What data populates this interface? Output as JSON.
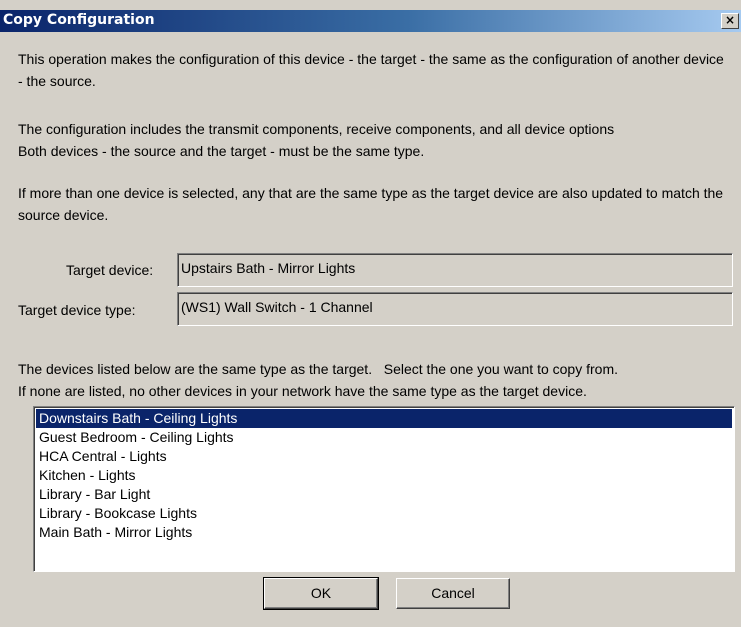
{
  "window": {
    "title": "Copy Configuration",
    "close_glyph": "×"
  },
  "description": {
    "p1": "This operation makes the configuration of this device - the target - the same as the configuration of another device - the source.",
    "p2_line1": "The configuration includes the transmit components, receive components, and all device options",
    "p2_line2": "Both devices - the source and the target - must be the same type.",
    "p3": "If more than one device is selected, any that are the same type as the target device are also updated to match the source device."
  },
  "target": {
    "device_label": "Target device:",
    "device_value": "Upstairs Bath - Mirror Lights",
    "type_label": "Target device type:",
    "type_value": "(WS1) Wall Switch - 1 Channel"
  },
  "list": {
    "instructions_line1": "The devices listed below are the same type as the target.   Select the one you want to copy from.",
    "instructions_line2": "If none are listed, no other devices in your network have the same type as the target device.",
    "selected_index": 0,
    "items": [
      "Downstairs Bath - Ceiling Lights",
      "Guest Bedroom - Ceiling Lights",
      "HCA Central - Lights",
      "Kitchen - Lights",
      "Library - Bar Light",
      "Library - Bookcase Lights",
      "Main Bath - Mirror Lights"
    ]
  },
  "buttons": {
    "ok": "OK",
    "cancel": "Cancel"
  }
}
